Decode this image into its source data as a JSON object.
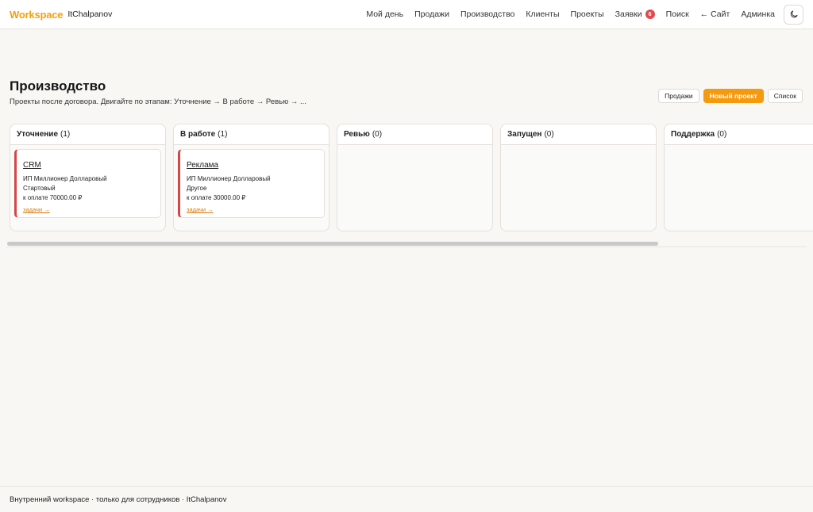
{
  "header": {
    "brand": "Workspace",
    "user": "ItChalpanov",
    "nav": [
      {
        "label": "Мой день"
      },
      {
        "label": "Продажи"
      },
      {
        "label": "Производство"
      },
      {
        "label": "Клиенты"
      },
      {
        "label": "Проекты"
      },
      {
        "label": "Заявки",
        "badge": "6"
      },
      {
        "label": "Поиск"
      },
      {
        "label": "← Сайт"
      },
      {
        "label": "Админка"
      }
    ],
    "theme_icon": "moon-icon"
  },
  "page": {
    "title": "Производство",
    "subtitle": "Проекты после договора. Двигайте по этапам: Уточнение → В работе → Ревью → ..."
  },
  "actions": {
    "sales": "Продажи",
    "new_project": "Новый проект",
    "list": "Список"
  },
  "columns": [
    {
      "title": "Уточнение",
      "count": "(1)",
      "cards": [
        {
          "title": "CRM",
          "client": "ИП Миллионер Долларовый",
          "plan": "Стартовый",
          "amount": "к оплате 70000.00 ₽",
          "link": "задачи →"
        }
      ]
    },
    {
      "title": "В работе",
      "count": "(1)",
      "cards": [
        {
          "title": "Реклама",
          "client": "ИП Миллионер Долларовый",
          "plan": "Другое",
          "amount": "к оплате 30000.00 ₽",
          "link": "задачи →"
        }
      ]
    },
    {
      "title": "Ревью",
      "count": "(0)",
      "cards": []
    },
    {
      "title": "Запущен",
      "count": "(0)",
      "cards": []
    },
    {
      "title": "Поддержка",
      "count": "(0)",
      "cards": []
    }
  ],
  "colors": {
    "accent": "#f59a0e",
    "card_border": "#d64545",
    "badge": "#e5484d"
  },
  "footer": {
    "text": "Внутренний workspace · только для сотрудников · ItChalpanov"
  }
}
